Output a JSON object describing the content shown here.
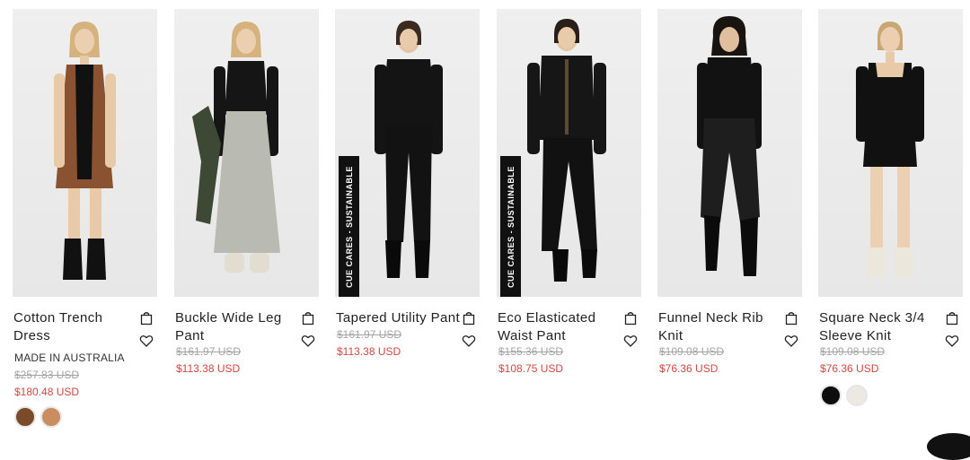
{
  "colors": {
    "sale": "#d7463f",
    "old_price": "#a4a4a4",
    "badge": "#111111",
    "background": "#ffffff"
  },
  "icons": {
    "bag": "shopping-bag-icon",
    "wishlist": "heart-icon"
  },
  "products": [
    {
      "name": "Cotton Trench Dress",
      "tag": "MADE IN AUSTRALIA",
      "old_price": "$257.83 USD",
      "sale_price": "$180.48 USD",
      "swatches": [
        {
          "color": "#7a4a2b"
        },
        {
          "color": "#c98d61"
        }
      ]
    },
    {
      "name": "Buckle Wide Leg Pant",
      "old_price": "$161.97 USD",
      "sale_price": "$113.38 USD"
    },
    {
      "name": "Tapered Utility Pant",
      "badge": "CUE CARES - SUSTAINABLE",
      "old_price": "$161.97 USD",
      "sale_price": "$113.38 USD"
    },
    {
      "name": "Eco Elasticated Waist Pant",
      "badge": "CUE CARES - SUSTAINABLE",
      "old_price": "$155.36 USD",
      "sale_price": "$108.75 USD"
    },
    {
      "name": "Funnel Neck Rib Knit",
      "old_price": "$109.08 USD",
      "sale_price": "$76.36 USD"
    },
    {
      "name": "Square Neck 3/4 Sleeve Knit",
      "old_price": "$109.08 USD",
      "sale_price": "$76.36 USD",
      "swatches": [
        {
          "color": "#0d0d0d"
        },
        {
          "color": "#ece9e3"
        }
      ]
    }
  ]
}
